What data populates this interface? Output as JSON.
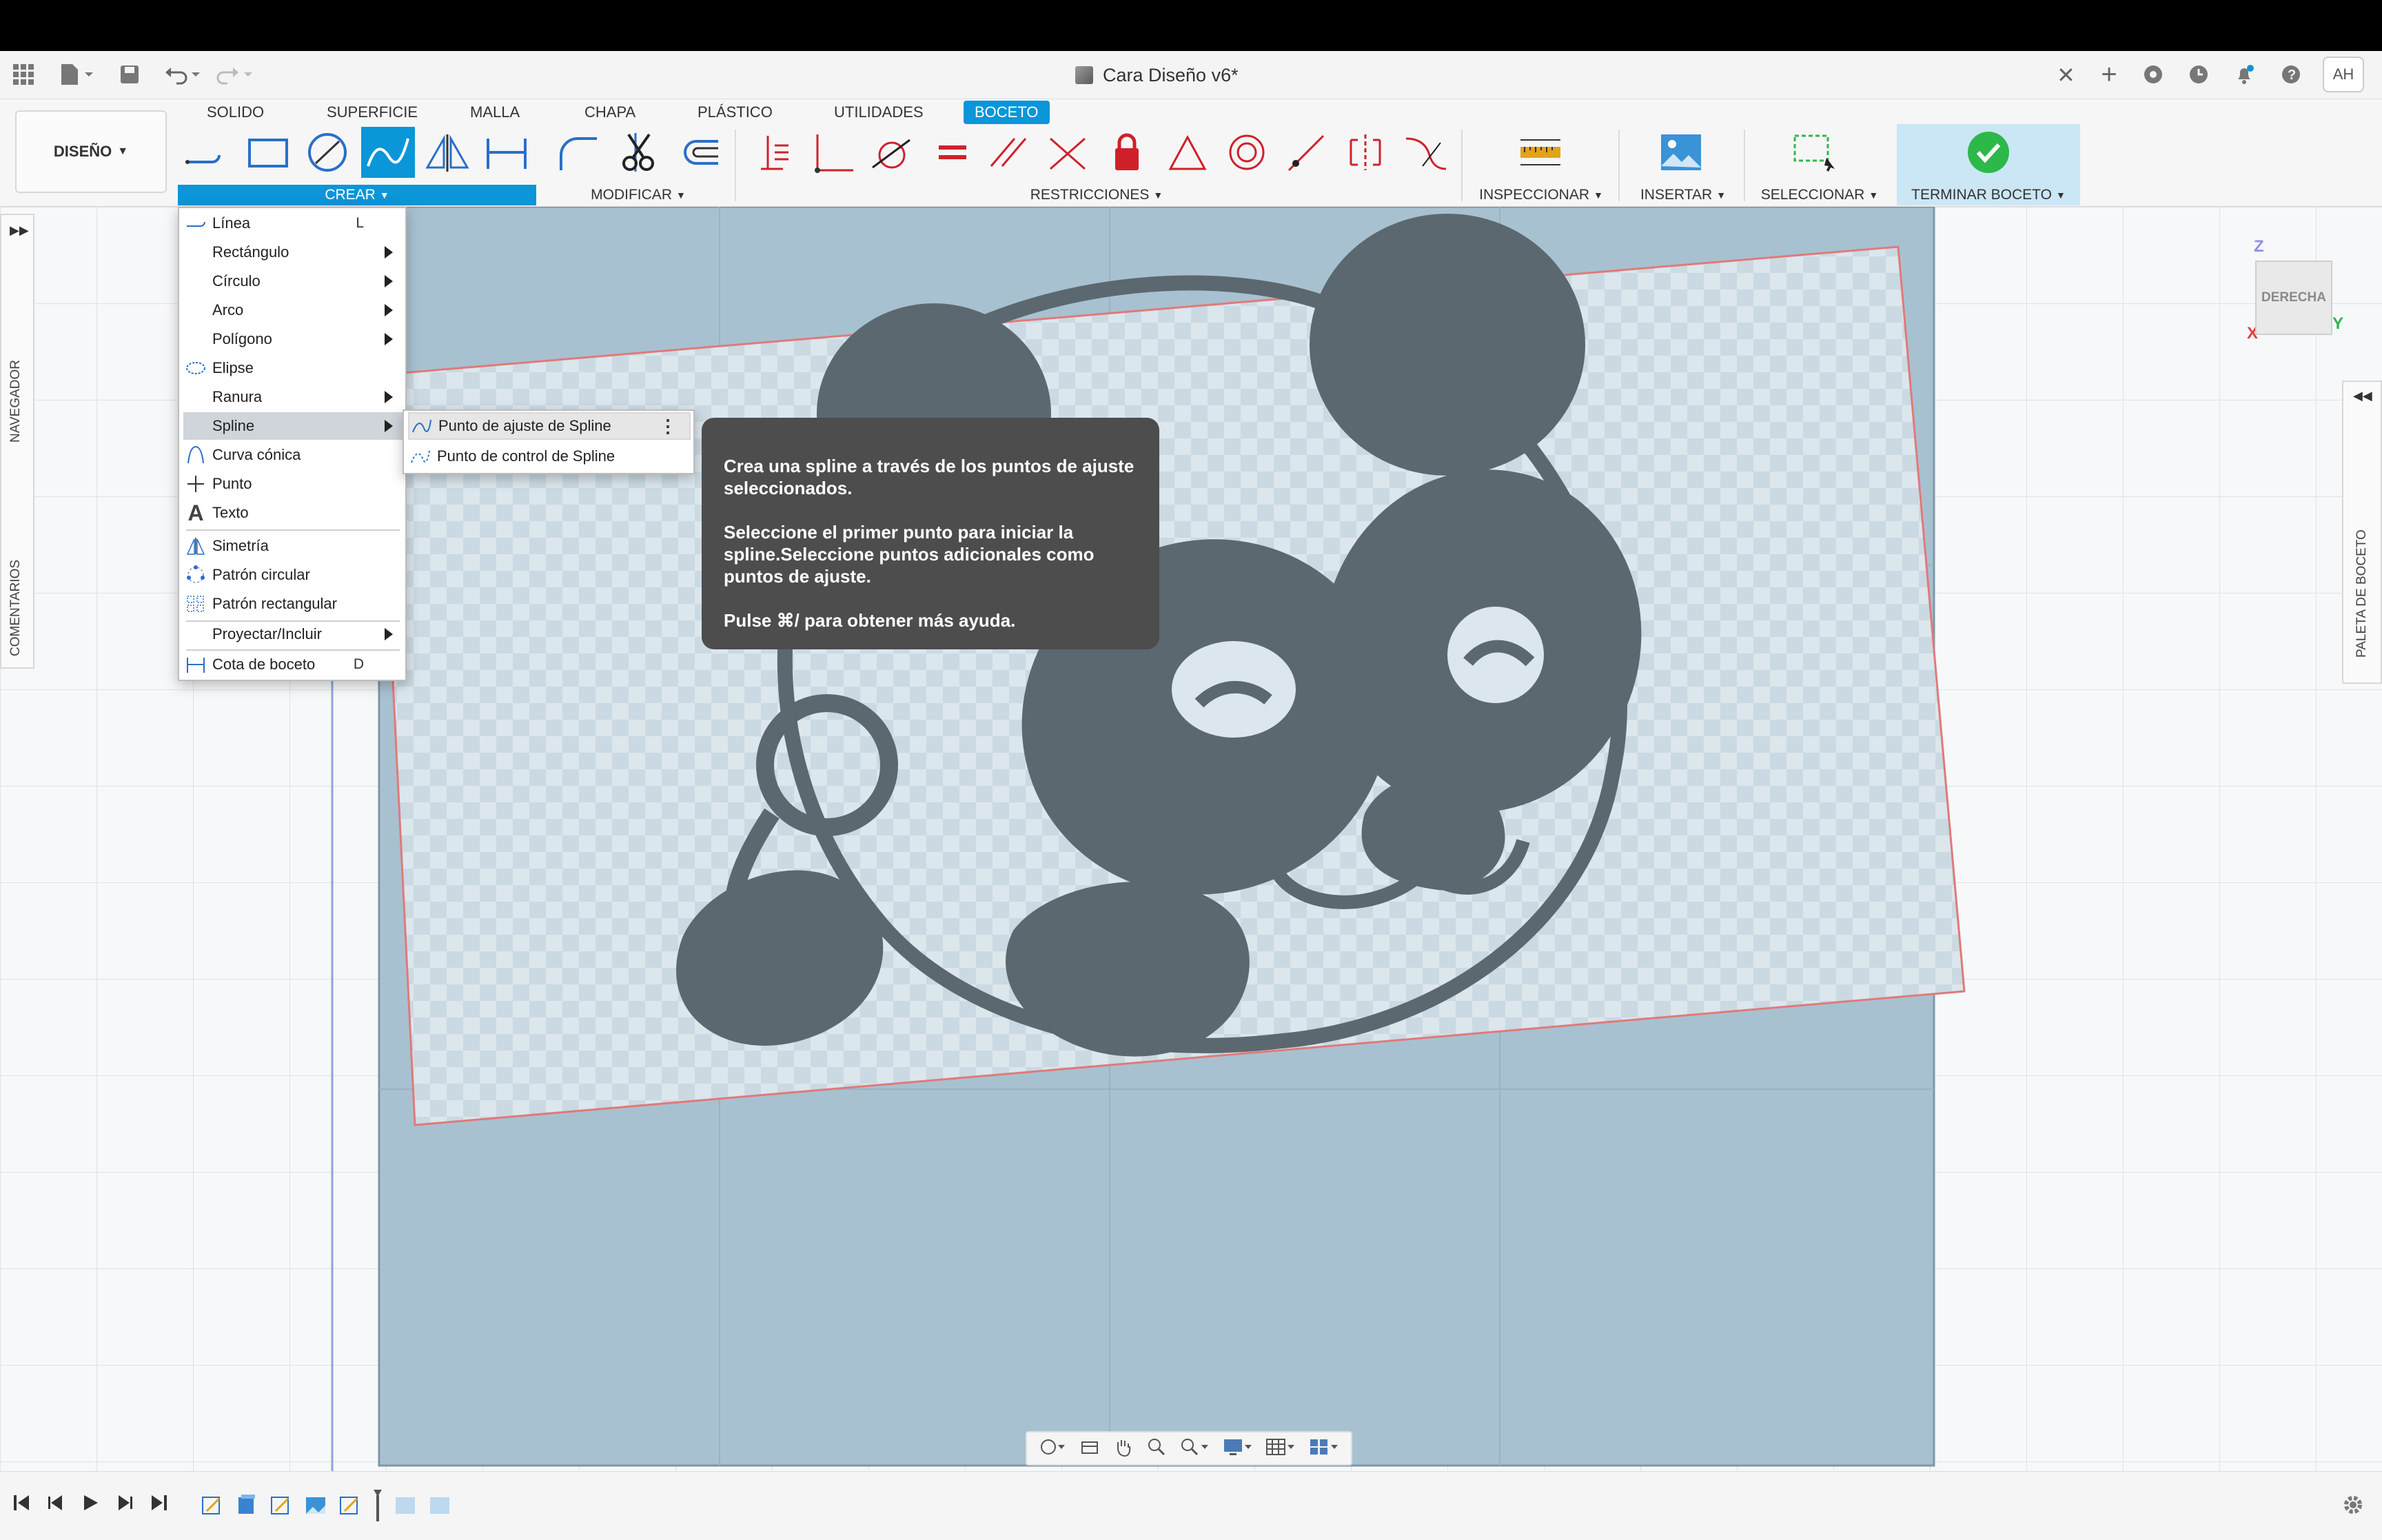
{
  "document": {
    "title": "Cara Diseño v6*"
  },
  "user": {
    "initials": "AH"
  },
  "workspace": {
    "label": "DISEÑO"
  },
  "tabs": [
    {
      "label": "SOLIDO"
    },
    {
      "label": "SUPERFICIE"
    },
    {
      "label": "MALLA"
    },
    {
      "label": "CHAPA"
    },
    {
      "label": "PLÁSTICO"
    },
    {
      "label": "UTILIDADES"
    },
    {
      "label": "BOCETO"
    }
  ],
  "groups": {
    "create": "CREAR",
    "modify": "MODIFICAR",
    "constraints": "RESTRICCIONES",
    "inspect": "INSPECCIONAR",
    "insert": "INSERTAR",
    "select": "SELECCIONAR",
    "finish": "TERMINAR BOCETO"
  },
  "create_menu": {
    "items": [
      {
        "label": "Línea",
        "shortcut": "L"
      },
      {
        "label": "Rectángulo"
      },
      {
        "label": "Círculo"
      },
      {
        "label": "Arco"
      },
      {
        "label": "Polígono"
      },
      {
        "label": "Elipse"
      },
      {
        "label": "Ranura"
      },
      {
        "label": "Spline"
      },
      {
        "label": "Curva cónica"
      },
      {
        "label": "Punto"
      },
      {
        "label": "Texto"
      },
      {
        "label": "Simetría"
      },
      {
        "label": "Patrón circular"
      },
      {
        "label": "Patrón rectangular"
      },
      {
        "label": "Proyectar/Incluir"
      },
      {
        "label": "Cota de boceto",
        "shortcut": "D"
      }
    ]
  },
  "spline_submenu": {
    "items": [
      {
        "label": "Punto de ajuste de Spline"
      },
      {
        "label": "Punto de control de Spline"
      }
    ]
  },
  "tooltip": {
    "p1": "Crea una spline a través de los puntos de ajuste seleccionados.",
    "p2": "Seleccione el primer punto para iniciar la spline.Seleccione puntos adicionales como puntos de ajuste.",
    "p3": "Pulse ⌘/ para obtener más ayuda."
  },
  "side_panels": {
    "navigator": "NAVEGADOR",
    "comments": "COMENTARIOS",
    "sketch_palette": "PALETA DE BOCETO"
  },
  "viewcube": {
    "face": "DERECHA",
    "axis_z": "Z",
    "axis_y": "Y",
    "axis_x": "X"
  },
  "colors": {
    "accent": "#0a96d8",
    "finish": "#2db84a",
    "constraint": "#d0202a",
    "panda": "#5c6870"
  }
}
